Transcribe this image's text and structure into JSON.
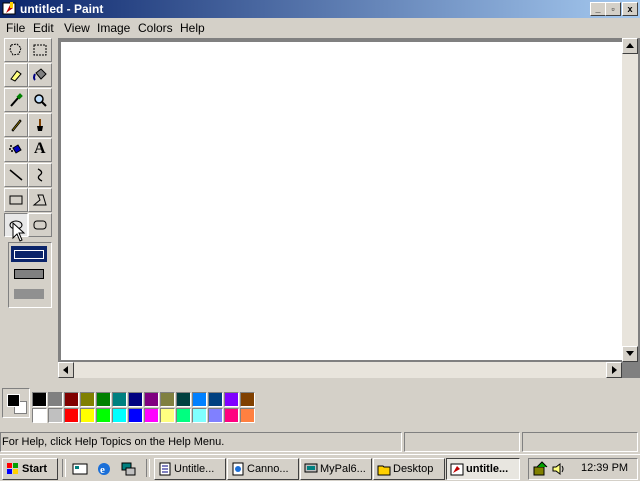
{
  "window": {
    "title": "untitled - Paint",
    "buttons": {
      "minimize": "_",
      "maximize": "▫",
      "close": "x"
    }
  },
  "menu": [
    "File",
    "Edit",
    "View",
    "Image",
    "Colors",
    "Help"
  ],
  "tools": [
    {
      "name": "free-form-select-icon"
    },
    {
      "name": "select-icon"
    },
    {
      "name": "eraser-icon"
    },
    {
      "name": "fill-icon"
    },
    {
      "name": "pick-color-icon"
    },
    {
      "name": "magnifier-icon"
    },
    {
      "name": "pencil-icon"
    },
    {
      "name": "brush-icon"
    },
    {
      "name": "airbrush-icon"
    },
    {
      "name": "text-icon",
      "glyph": "A"
    },
    {
      "name": "line-icon"
    },
    {
      "name": "curve-icon"
    },
    {
      "name": "rectangle-icon"
    },
    {
      "name": "polygon-icon"
    },
    {
      "name": "ellipse-icon"
    },
    {
      "name": "rounded-rectangle-icon"
    }
  ],
  "active_tool": "ellipse-icon",
  "palette": {
    "foreground": "#000000",
    "background": "#ffffff",
    "row1": [
      "#000000",
      "#808080",
      "#800000",
      "#808000",
      "#008000",
      "#008080",
      "#000080",
      "#800080",
      "#808040",
      "#004040",
      "#0080ff",
      "#004080",
      "#8000ff",
      "#804000"
    ],
    "row2": [
      "#ffffff",
      "#c0c0c0",
      "#ff0000",
      "#ffff00",
      "#00ff00",
      "#00ffff",
      "#0000ff",
      "#ff00ff",
      "#ffff80",
      "#00ff80",
      "#80ffff",
      "#8080ff",
      "#ff0080",
      "#ff8040"
    ]
  },
  "status": {
    "help_text": "For Help, click Help Topics on the Help Menu."
  },
  "taskbar": {
    "start": "Start",
    "tasks": [
      {
        "label": "Untitle...",
        "icon": "notepad-icon"
      },
      {
        "label": "Canno...",
        "icon": "ie-page-icon"
      },
      {
        "label": "MyPal6...",
        "icon": "computer-icon"
      },
      {
        "label": "Desktop",
        "icon": "folder-icon"
      },
      {
        "label": "untitle...",
        "icon": "paint-icon",
        "active": true
      }
    ],
    "clock": "12:39 PM"
  }
}
